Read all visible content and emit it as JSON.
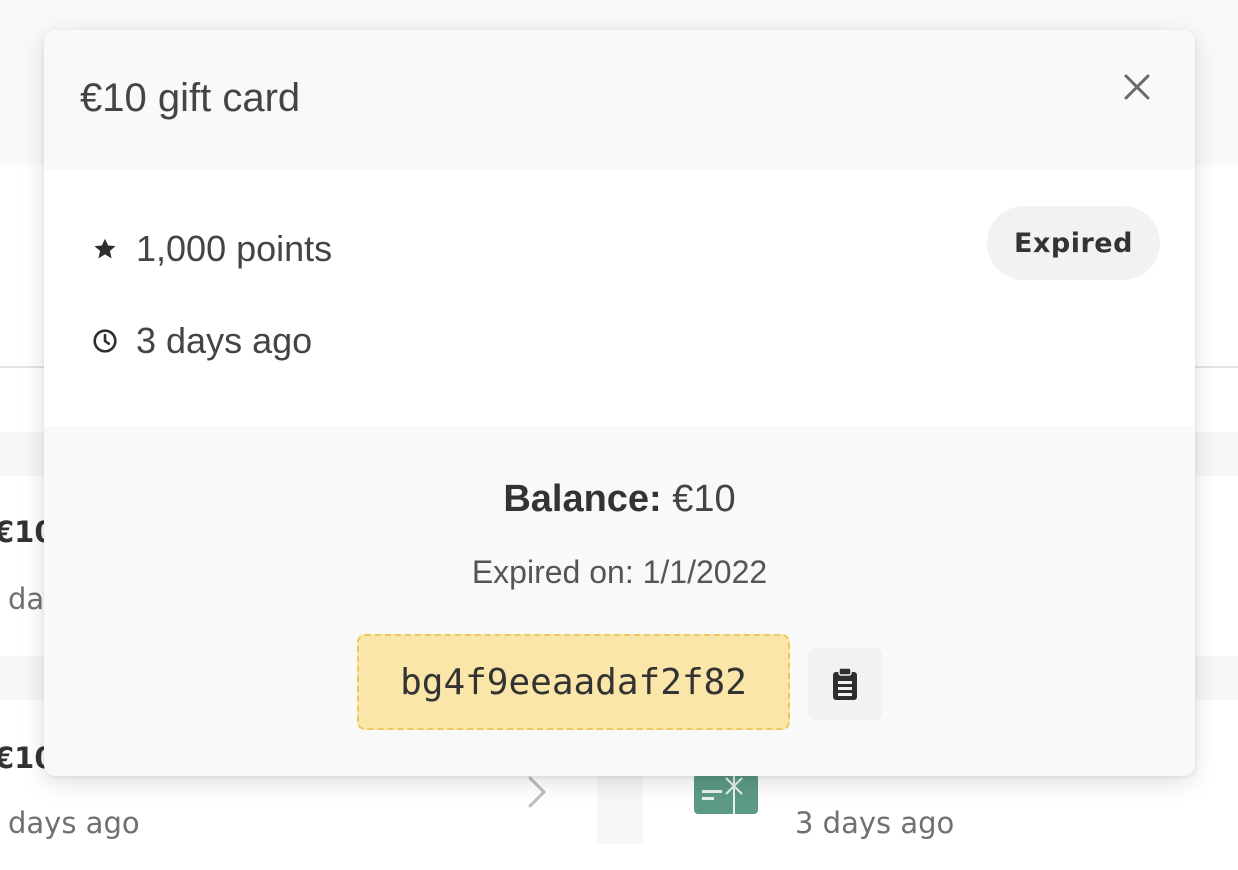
{
  "background": {
    "rows": [
      {
        "title": "€10",
        "subtitle": "da"
      },
      {
        "title": "€10",
        "subtitle": "days ago"
      }
    ],
    "right_subtitle": "3 days ago",
    "icons": {
      "chevron": "chevron-right-icon",
      "gift": "gift-card-icon"
    }
  },
  "popover": {
    "title": "€10 gift card",
    "close_icon": "close-icon",
    "points": {
      "icon": "star-icon",
      "text": "1,000 points"
    },
    "time": {
      "icon": "clock-icon",
      "text": "3 days ago"
    },
    "status_badge": "Expired",
    "balance": {
      "label": "Balance:",
      "value": "€10"
    },
    "expiry": "Expired on: 1/1/2022",
    "code": "bg4f9eeaadaf2f82",
    "copy_icon": "clipboard-icon"
  },
  "colors": {
    "code_background": "#fbe6a9",
    "code_border": "#ecc95e",
    "badge_background": "#f1f2f4",
    "gift_icon": "#5c9a87"
  }
}
